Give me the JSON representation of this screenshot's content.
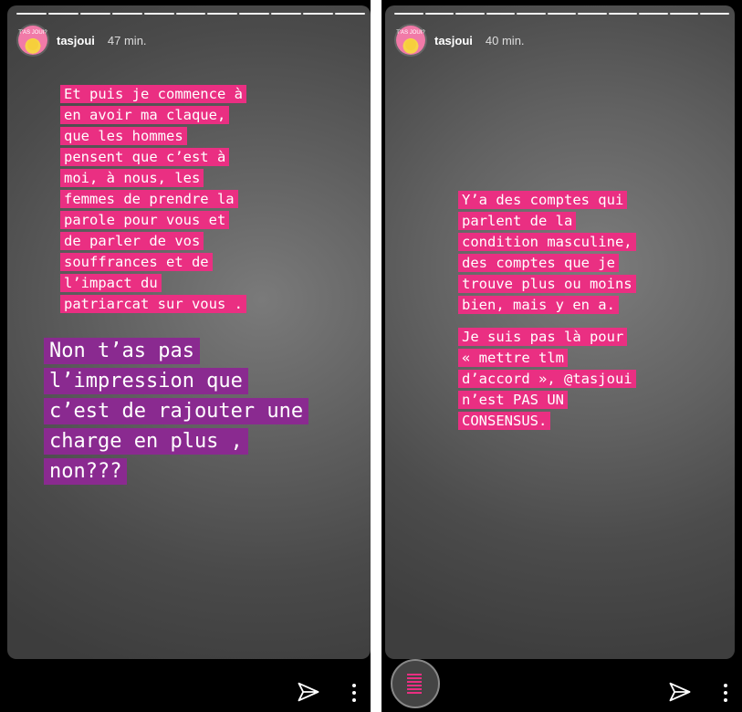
{
  "left_story": {
    "username": "tasjoui",
    "time": "47 min.",
    "avatar_text": "T'AS JOUI?",
    "progress_segments": 11,
    "progress_done": 11,
    "pink_lines": [
      "Et puis je commence à",
      "en avoir ma claque,",
      "que les hommes",
      "pensent que c’est à",
      "moi, à nous, les",
      "femmes de prendre la",
      "parole pour vous et",
      "de parler de vos",
      "souffrances et de",
      "l’impact du",
      "patriarcat sur vous ."
    ],
    "purple_lines": [
      "Non t’as pas",
      "l’impression que",
      "c’est de rajouter une",
      "charge en plus ,",
      "non???"
    ]
  },
  "right_story": {
    "username": "tasjoui",
    "time": "40 min.",
    "avatar_text": "T'AS JOUI?",
    "progress_segments": 11,
    "progress_done": 11,
    "pink_lines_1": [
      "Y’a des comptes qui",
      "parlent de la",
      "condition masculine,",
      "des comptes que je",
      "trouve plus ou moins",
      "bien, mais y en a."
    ],
    "pink_lines_2": [
      "Je suis pas là pour",
      "« mettre tlm",
      "d’accord », @tasjoui",
      "n’est PAS UN",
      "CONSENSUS."
    ]
  },
  "icons": {
    "send": "paper-plane-icon",
    "more": "vertical-dots-icon"
  },
  "colors": {
    "pink_highlight": "#ea2f82",
    "purple_highlight": "#8a2a90",
    "background": "#000000"
  }
}
